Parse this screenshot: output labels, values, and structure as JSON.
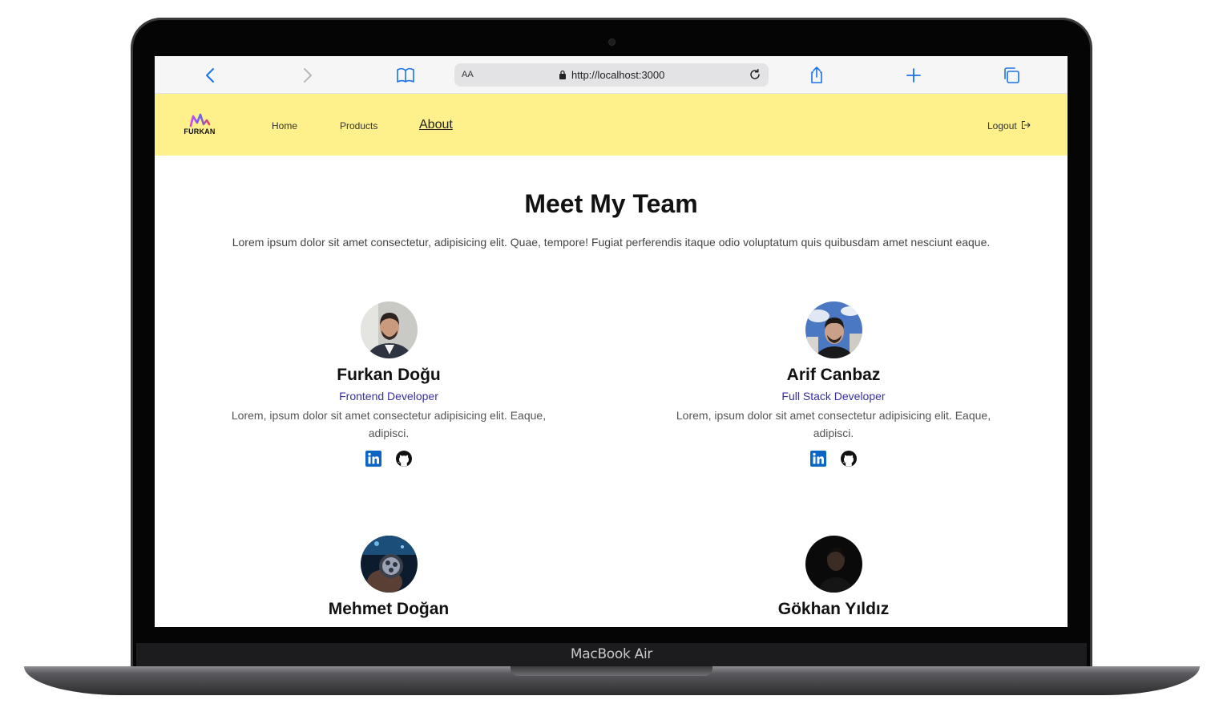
{
  "device": {
    "label": "MacBook Air"
  },
  "browser": {
    "text_size_label": "AA",
    "url": "http://localhost:3000"
  },
  "nav": {
    "logo_text": "FURKAN",
    "links": [
      "Home",
      "Products",
      "About"
    ],
    "active": "About",
    "logout_label": "Logout"
  },
  "page": {
    "title": "Meet My Team",
    "subtitle": "Lorem ipsum dolor sit amet consectetur, adipisicing elit. Quae, tempore! Fugiat perferendis itaque odio voluptatum quis quibusdam amet nesciunt eaque."
  },
  "team": [
    {
      "name": "Furkan Doğu",
      "role": "Frontend Developer",
      "bio": "Lorem, ipsum dolor sit amet consectetur adipisicing elit. Eaque, adipisci.",
      "social": [
        "linkedin-icon",
        "github-icon"
      ]
    },
    {
      "name": "Arif Canbaz",
      "role": "Full Stack Developer",
      "bio": "Lorem, ipsum dolor sit amet consectetur adipisicing elit. Eaque, adipisci.",
      "social": [
        "linkedin-icon",
        "github-icon"
      ]
    },
    {
      "name": "Mehmet Doğan"
    },
    {
      "name": "Gökhan Yıldız"
    }
  ],
  "colors": {
    "navbar_bg": "#fef08a",
    "role_text": "#3730a3",
    "linkedin": "#0a66c2",
    "browser_accent": "#1a73e8"
  }
}
